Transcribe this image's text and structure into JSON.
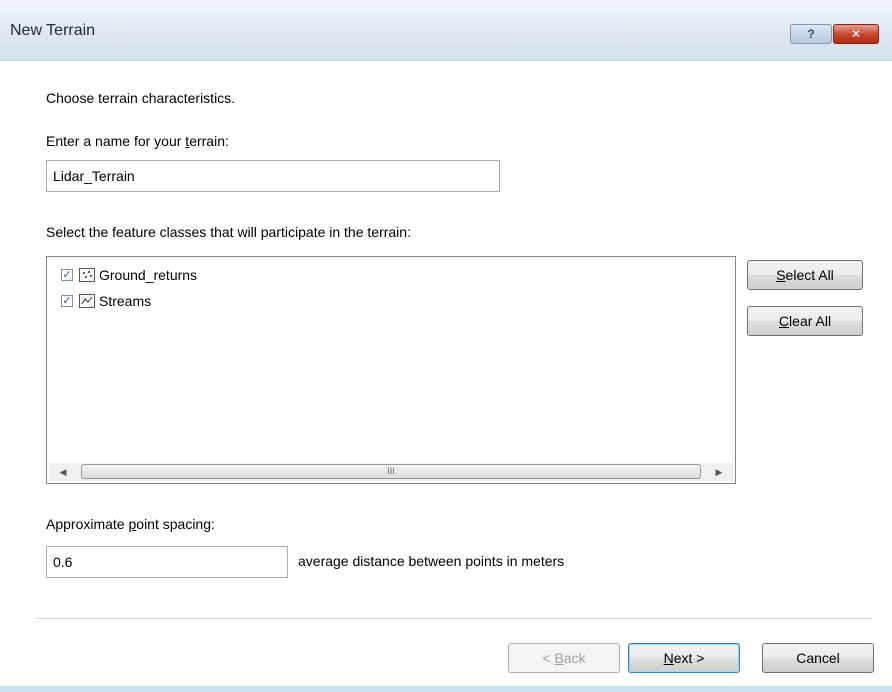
{
  "window": {
    "title": "New Terrain",
    "help_label": "?",
    "close_label": "✕"
  },
  "intro_text": "Choose terrain characteristics.",
  "name_field": {
    "label_prefix": "Enter a name for your ",
    "label_key": "t",
    "label_suffix": "errain:",
    "value": "Lidar_Terrain"
  },
  "feature_classes": {
    "label": "Select the feature classes that will participate in the terrain:",
    "items": [
      {
        "label": "Ground_returns",
        "checked": true,
        "icon": "multipoint-feature-class-icon"
      },
      {
        "label": "Streams",
        "checked": true,
        "icon": "line-feature-class-icon"
      }
    ],
    "scroll_grip": "III"
  },
  "select_all": {
    "key": "S",
    "rest": "elect All"
  },
  "clear_all": {
    "key": "C",
    "rest": "lear All"
  },
  "spacing": {
    "label_prefix": "Approximate ",
    "label_key": "p",
    "label_suffix": "oint spacing:",
    "value": "0.6",
    "unit_text": "average distance between points in meters"
  },
  "buttons": {
    "back_prefix": "< ",
    "back_key": "B",
    "back_suffix": "ack",
    "next_key": "N",
    "next_suffix": "ext >",
    "cancel": "Cancel"
  },
  "check_mark": "✓"
}
